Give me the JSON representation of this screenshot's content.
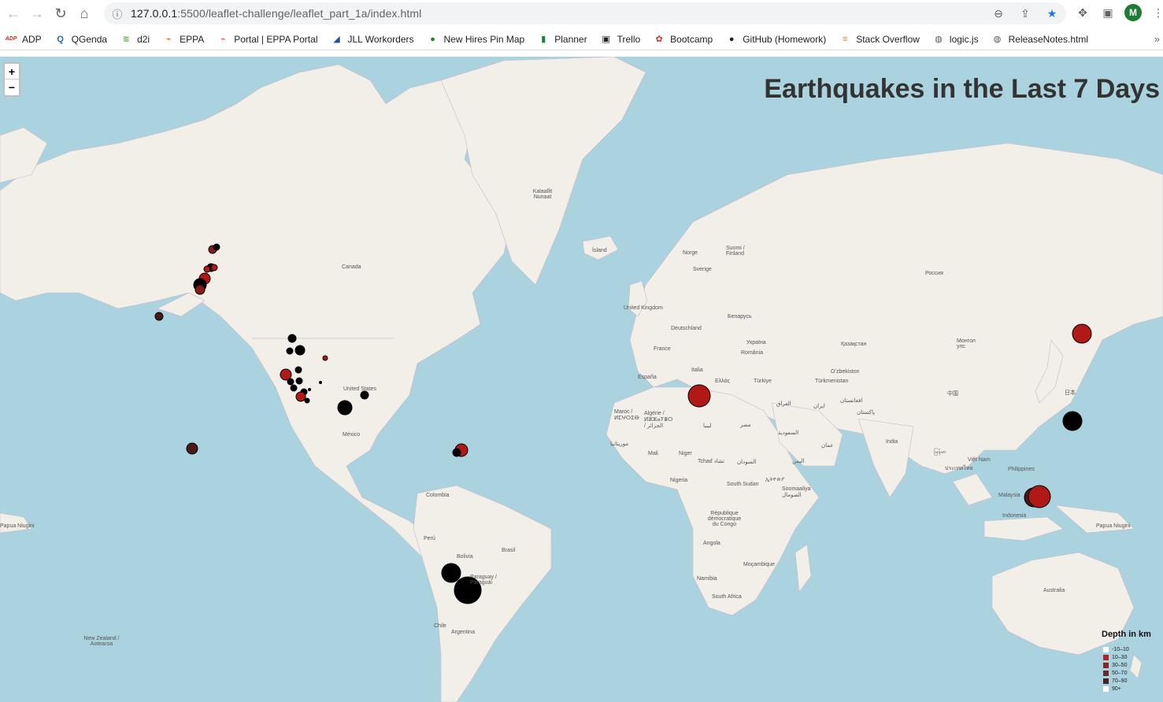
{
  "browser": {
    "url_host": "127.0.0.1",
    "url_path": ":5500/leaflet-challenge/leaflet_part_1a/index.html",
    "avatar_letter": "M"
  },
  "bookmarks": [
    {
      "label": "ADP",
      "icon": "adp-icon",
      "color": "#d0271d",
      "glyph": "ADP"
    },
    {
      "label": "QGenda",
      "icon": "qgenda-icon",
      "color": "#1a6fb5",
      "glyph": "Q"
    },
    {
      "label": "d2i",
      "icon": "d2i-icon",
      "color": "#6aa84f",
      "glyph": "≋"
    },
    {
      "label": "EPPA",
      "icon": "eppa-icon",
      "color": "#e06c3a",
      "glyph": "⌁"
    },
    {
      "label": "Portal | EPPA Portal",
      "icon": "eppa-portal-icon",
      "color": "#e06c3a",
      "glyph": "⌁"
    },
    {
      "label": "JLL Workorders",
      "icon": "jll-icon",
      "color": "#1c4fa0",
      "glyph": "◢"
    },
    {
      "label": "New Hires Pin Map",
      "icon": "pin-map-icon",
      "color": "#2e7d32",
      "glyph": "●"
    },
    {
      "label": "Planner",
      "icon": "planner-icon",
      "color": "#1f7a3f",
      "glyph": "▮"
    },
    {
      "label": "Trello",
      "icon": "trello-icon",
      "color": "#222",
      "glyph": "▣"
    },
    {
      "label": "Bootcamp",
      "icon": "bootcamp-icon",
      "color": "#d32f2f",
      "glyph": "✿"
    },
    {
      "label": "GitHub (Homework)",
      "icon": "github-icon",
      "color": "#222",
      "glyph": "●"
    },
    {
      "label": "Stack Overflow",
      "icon": "stackoverflow-icon",
      "color": "#f48024",
      "glyph": "≡"
    },
    {
      "label": "logic.js",
      "icon": "globe-icon",
      "color": "#555",
      "glyph": "◍"
    },
    {
      "label": "ReleaseNotes.html",
      "icon": "globe-icon",
      "color": "#555",
      "glyph": "◍"
    }
  ],
  "map": {
    "title": "Earthquakes in the Last 7 Days",
    "zoom_in": "+",
    "zoom_out": "−",
    "legend": {
      "title": "Depth in km",
      "items": [
        {
          "label": "-10–10",
          "color": "#ffffff"
        },
        {
          "label": "10–30",
          "color": "#b22222"
        },
        {
          "label": "30–50",
          "color": "#8b2323"
        },
        {
          "label": "50–70",
          "color": "#6b2a2a"
        },
        {
          "label": "70–90",
          "color": "#4a2424"
        },
        {
          "label": "90+",
          "color": "#ffffff"
        }
      ]
    },
    "places": [
      "Kalaallit Nunaat",
      "Ísland",
      "Norge",
      "Suomi / Finland",
      "Sverige",
      "Россия",
      "United Kingdom",
      "Deutschland",
      "Беларусь",
      "France",
      "Україна",
      "România",
      "Italia",
      "Ελλάς",
      "Türkiye",
      "España",
      "Қазақстан",
      "Монгол улс",
      "Oʻzbekiston",
      "Türkmenistan",
      "中国",
      "日本",
      "Canada",
      "United States",
      "México",
      "Colombia",
      "Perú",
      "Brasil",
      "Bolivia",
      "Paraguay / Paraguái",
      "Chile",
      "Argentina",
      "Maroc / ⵍⵎⵖⵔⵉⴱ",
      "Algérie / ⵍⵣⵣⴰⵢⴻⵔ / الجزائر",
      "ليبيا",
      "مصر",
      "Mali",
      "Niger",
      "Tchad تشاد",
      "السودان",
      "Nigeria",
      "South Sudan",
      "ኢትዮጵያ",
      "Soomaaliya الصومال",
      "République démocratique du Congo",
      "Angola",
      "Namibia",
      "South Africa",
      "Moçambique",
      "السعودية",
      "العراق",
      "ایران",
      "افغانستان",
      "پاکستان",
      "India",
      "ประเทศไทย",
      "Việt Nam",
      "Philippines",
      "Malaysia",
      "Indonesia",
      "Papua Niugini",
      "Australia",
      "New Zealand / Aotearoa",
      "موريتانيا",
      "اليمن",
      "عمان",
      "မြန်မာ"
    ]
  }
}
